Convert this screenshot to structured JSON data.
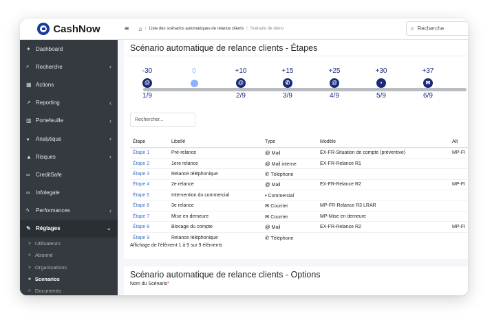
{
  "brand": {
    "name": "CashNow"
  },
  "sidebar": {
    "items": [
      {
        "label": "Dashboard",
        "icon": "tachometer-icon",
        "glyph": "✦",
        "chevron": ""
      },
      {
        "label": "Recherche",
        "icon": "search-icon",
        "glyph": "⌕",
        "chevron": "‹"
      },
      {
        "label": "Actions",
        "icon": "calendar-icon",
        "glyph": "▦",
        "chevron": ""
      },
      {
        "label": "Reporting",
        "icon": "chart-icon",
        "glyph": "↗",
        "chevron": "‹"
      },
      {
        "label": "Portefeuille",
        "icon": "wallet-icon",
        "glyph": "▥",
        "chevron": "‹"
      },
      {
        "label": "Analytique",
        "icon": "pie-chart-icon",
        "glyph": "◕",
        "chevron": "‹"
      },
      {
        "label": "Risques",
        "icon": "warning-icon",
        "glyph": "▲",
        "chevron": "‹"
      },
      {
        "label": "CreditSafe",
        "icon": "binoculars-icon",
        "glyph": "∞",
        "chevron": ""
      },
      {
        "label": "Infolegale",
        "icon": "binoculars-icon",
        "glyph": "∞",
        "chevron": ""
      },
      {
        "label": "Performances",
        "icon": "bolt-icon",
        "glyph": "ϟ",
        "chevron": "‹"
      },
      {
        "label": "Réglages",
        "icon": "wrench-icon",
        "glyph": "✎",
        "chevron": "⌄"
      }
    ],
    "subitems": [
      {
        "label": "Utilisateurs",
        "arrow": "»"
      },
      {
        "label": "Abonné",
        "arrow": "»"
      },
      {
        "label": "Organisations",
        "arrow": "»"
      },
      {
        "label": "Scenarios",
        "arrow": "»"
      },
      {
        "label": "Documents",
        "arrow": "»"
      }
    ]
  },
  "topbar": {
    "menu_glyph": "≡",
    "home_glyph": "⌂",
    "breadcrumb": [
      "Liste des scénarios automatiques de relance clients",
      "Scénario de démo"
    ],
    "separator": "/",
    "search_placeholder": "Recherche",
    "search_glyph": "⌕"
  },
  "steps_card": {
    "title": "Scénario automatique de relance clients - Étapes",
    "timeline": [
      {
        "offset": "-30",
        "index": "1/9",
        "glyph": "@",
        "icon": "email-icon"
      },
      {
        "offset": "0",
        "index": "",
        "glyph": "",
        "icon": "today-marker"
      },
      {
        "offset": "+10",
        "index": "2/9",
        "glyph": "@",
        "icon": "email-icon"
      },
      {
        "offset": "+15",
        "index": "3/9",
        "glyph": "✆",
        "icon": "phone-icon"
      },
      {
        "offset": "+25",
        "index": "4/9",
        "glyph": "@",
        "icon": "email-icon"
      },
      {
        "offset": "+30",
        "index": "5/9",
        "glyph": "▪",
        "icon": "briefcase-icon"
      },
      {
        "offset": "+37",
        "index": "6/9",
        "glyph": "✉",
        "icon": "envelope-icon"
      }
    ],
    "search_placeholder": "Rechercher...",
    "columns": [
      "Étape",
      "Libellé",
      "Type",
      "Modèle",
      "Alt"
    ],
    "rows": [
      {
        "step": "Étape 1",
        "label": "Pré-relance",
        "type": "Mail",
        "type_glyph": "@",
        "model": "EX-FR-Situation de compte (préventive)",
        "alt": "MP-FI"
      },
      {
        "step": "Étape 2",
        "label": "1ere relance",
        "type": "Mail interne",
        "type_glyph": "@",
        "model": "EX-FR-Relance R1",
        "alt": ""
      },
      {
        "step": "Étape 3",
        "label": "Relance téléphonique",
        "type": "Téléphone",
        "type_glyph": "✆",
        "model": "",
        "alt": ""
      },
      {
        "step": "Étape 4",
        "label": "2e relance",
        "type": "Mail",
        "type_glyph": "@",
        "model": "EX-FR-Relance R2",
        "alt": "MP-FI"
      },
      {
        "step": "Étape 5",
        "label": "Intervention du commercial",
        "type": "Commercial",
        "type_glyph": "▪",
        "model": "",
        "alt": ""
      },
      {
        "step": "Étape 6",
        "label": "3e relance",
        "type": "Courrier",
        "type_glyph": "✉",
        "model": "MP-FR-Relance R3 LRAR",
        "alt": ""
      },
      {
        "step": "Étape 7",
        "label": "Mise en demeure",
        "type": "Courrier",
        "type_glyph": "✉",
        "model": "MP-Mise en demeure",
        "alt": ""
      },
      {
        "step": "Étape 8",
        "label": "Blocage du compte",
        "type": "Mail",
        "type_glyph": "@",
        "model": "EX-FR-Relance R2",
        "alt": "MP-FI"
      },
      {
        "step": "Étape 9",
        "label": "Relance téléphonique",
        "type": "Téléphone",
        "type_glyph": "✆",
        "model": "",
        "alt": ""
      }
    ],
    "info": "Affichage de l'élément 1 à 9 sur 9 éléments"
  },
  "options_card": {
    "title": "Scénario automatique de relance clients - Options",
    "field_label": "Nom du Scénario",
    "required_mark": "*"
  },
  "colors": {
    "sidebar": "#343a40",
    "brand_blue": "#1a3aa0",
    "timeline_node": "#1a2a7a",
    "today": "#8ab0ff",
    "link": "#3a73c9"
  }
}
